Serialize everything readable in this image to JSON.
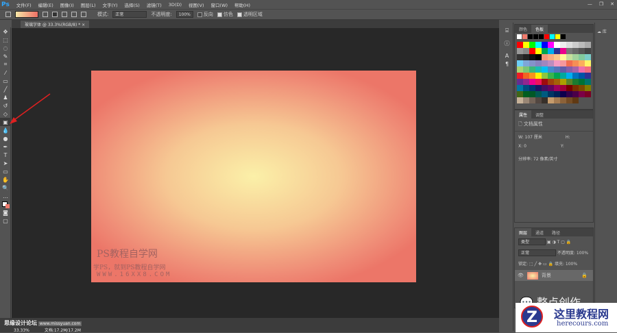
{
  "app": {
    "logo": "Ps",
    "menu": [
      "文件(F)",
      "编辑(E)",
      "图像(I)",
      "图层(L)",
      "文字(Y)",
      "选择(S)",
      "滤镜(T)",
      "3D(D)",
      "视图(V)",
      "窗口(W)",
      "帮助(H)"
    ],
    "win": [
      "—",
      "❐",
      "✕"
    ]
  },
  "options": {
    "mode_label": "模式:",
    "mode": "正常",
    "opacity_label": "不透明度:",
    "opacity": "100%",
    "reverse": "反向",
    "dither": "仿色",
    "transparency": "透明区域"
  },
  "tab": {
    "title": "玻璃字体 @ 33.3%(RGB/8) *",
    "close": "×"
  },
  "watermark": {
    "l1": "PS教程自学网",
    "l2": "学PS，就到PS教程自学网",
    "l3": "WWW.16XX8.COM",
    "forum": "思缘设计论坛",
    "forum_url": "www.missyuan.com",
    "author": "整点创作",
    "site": "这里教程网",
    "site_url": "herecours.com"
  },
  "status": {
    "zoom": "33.33%",
    "doc": "文档:17.2M/17.2M"
  },
  "swatches": {
    "tabs": [
      "颜色",
      "色板"
    ],
    "colors": [
      "#ff0000",
      "#ffff00",
      "#00ff00",
      "#00ffff",
      "#0000ff",
      "#ff00ff",
      "#ffffff",
      "#eeeeee",
      "#dddddd",
      "#cccccc",
      "#bbbbbb",
      "#aaaaaa",
      "#999999",
      "#888888",
      "#ff0000",
      "#ffff00",
      "#00a651",
      "#00aeef",
      "#2e3192",
      "#ec008c",
      "#777777",
      "#666666",
      "#555555",
      "#444444",
      "#333333",
      "#222222",
      "#111111",
      "#000000",
      "#f7977a",
      "#f9ad81",
      "#fdc68a",
      "#fff79a",
      "#c4df9b",
      "#a3d39c",
      "#82ca9d",
      "#7bcdc8",
      "#6ecff6",
      "#7ea7d8",
      "#8493ca",
      "#8882be",
      "#a187be",
      "#bc8dbf",
      "#f49ac2",
      "#f6989d",
      "#f26c4f",
      "#f68e55",
      "#fbaf5c",
      "#fff467",
      "#acd372",
      "#7cc576",
      "#3bb878",
      "#1abbb4",
      "#00bff3",
      "#438ccb",
      "#5574b9",
      "#605ca8",
      "#855fa8",
      "#a763a8",
      "#f06eaa",
      "#f26d7d",
      "#ed1c24",
      "#f26522",
      "#f7941d",
      "#fff200",
      "#8dc63f",
      "#39b54a",
      "#00a651",
      "#00a99d",
      "#00aeef",
      "#0072bc",
      "#0054a6",
      "#2e3192",
      "#662d91",
      "#92278f",
      "#ec008c",
      "#ed145b",
      "#9e0b0f",
      "#a0410d",
      "#a36209",
      "#aba000",
      "#598527",
      "#1a7b30",
      "#007236",
      "#00746b",
      "#0076a3",
      "#004b80",
      "#003471",
      "#1b1464",
      "#440e62",
      "#630460",
      "#9e005d",
      "#9e0039",
      "#790000",
      "#7b2e00",
      "#7d4900",
      "#827b00",
      "#406618",
      "#005e20",
      "#005826",
      "#005952",
      "#005b7f",
      "#003663",
      "#002157",
      "#0d004c",
      "#32004b",
      "#4b0049",
      "#7b0046",
      "#7a0026",
      "#c7b299",
      "#998675",
      "#736357",
      "#534741",
      "#37302a",
      "#c69c6d",
      "#a67c52",
      "#8c6239",
      "#754c24",
      "#603913"
    ]
  },
  "properties": {
    "tabs": [
      "属性",
      "调整"
    ],
    "title": "文档属性",
    "w_label": "W:",
    "w": "107 厘米",
    "h_label": "H:",
    "x_label": "X:",
    "x": "0",
    "y_label": "Y:",
    "res": "分辨率: 72 像素/英寸"
  },
  "layers": {
    "tabs": [
      "图层",
      "通道",
      "路径"
    ],
    "filter": "类型",
    "blend": "正常",
    "opacity_label": "不透明度:",
    "opacity": "100%",
    "lock": "锁定:",
    "fill_label": "填充:",
    "fill": "100%",
    "layer": "背景"
  },
  "library": "库"
}
